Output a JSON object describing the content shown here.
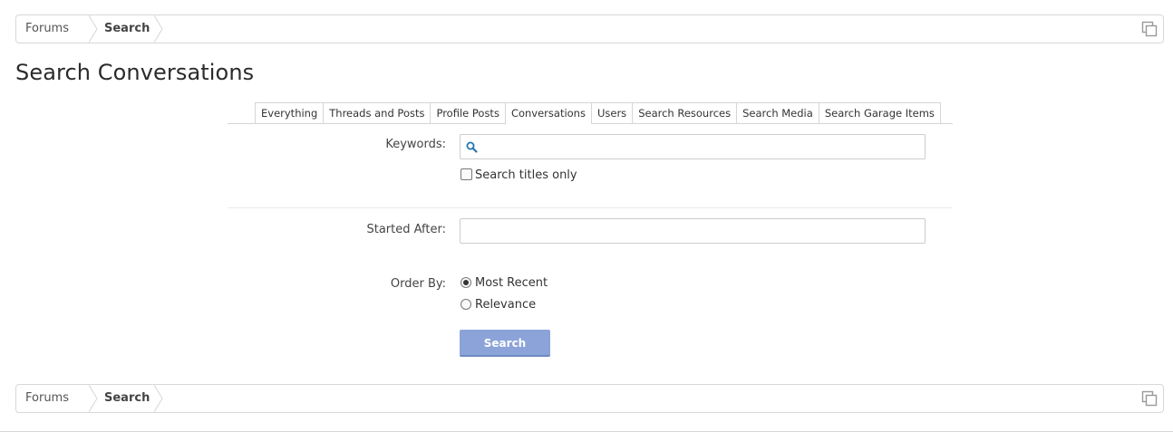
{
  "breadcrumb": {
    "home": "Forums",
    "current": "Search"
  },
  "page_title": "Search Conversations",
  "tabs": [
    {
      "label": "Everything"
    },
    {
      "label": "Threads and Posts"
    },
    {
      "label": "Profile Posts"
    },
    {
      "label": "Conversations",
      "active": true
    },
    {
      "label": "Users"
    },
    {
      "label": "Search Resources"
    },
    {
      "label": "Search Media"
    },
    {
      "label": "Search Garage Items"
    }
  ],
  "form": {
    "keywords_label": "Keywords:",
    "keywords_value": "",
    "titles_only_label": "Search titles only",
    "started_after_label": "Started After:",
    "started_after_value": "",
    "order_by_label": "Order By:",
    "order_options": [
      {
        "label": "Most Recent",
        "checked": true
      },
      {
        "label": "Relevance",
        "checked": false
      }
    ],
    "search_button": "Search"
  },
  "colors": {
    "button_bg": "#8ba3d8",
    "accent": "#2577b1"
  },
  "icons": {
    "copy": "copy-icon",
    "search": "search-icon"
  }
}
